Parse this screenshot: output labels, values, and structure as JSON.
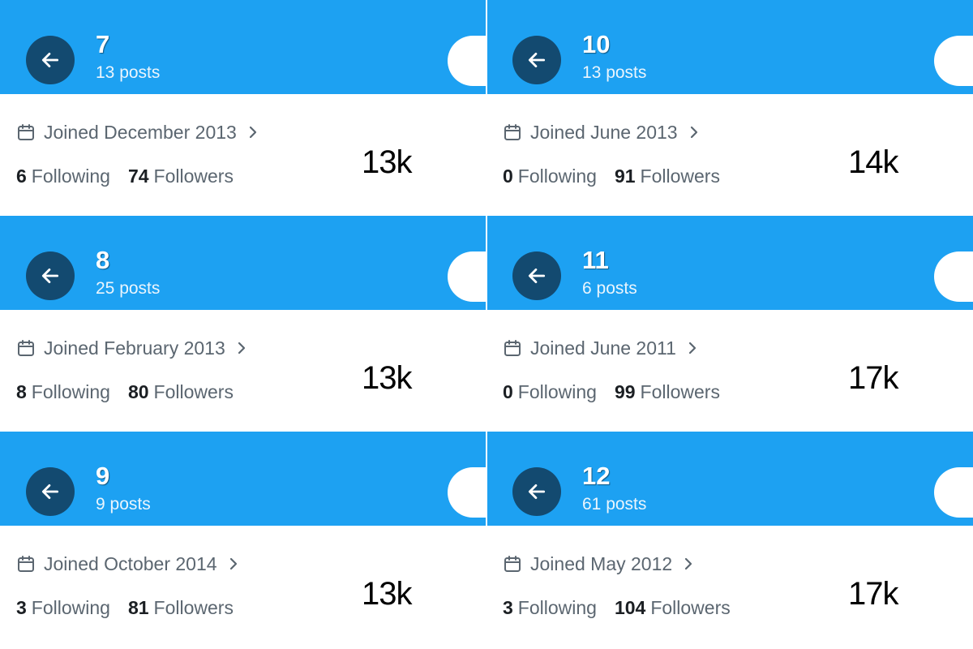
{
  "panels": [
    {
      "name": "7",
      "posts": "13 posts",
      "joined": "Joined December 2013",
      "following_count": "6",
      "following_label": "Following",
      "followers_count": "74",
      "followers_label": "Followers",
      "overlay": "13k"
    },
    {
      "name": "10",
      "posts": "13 posts",
      "joined": "Joined June 2013",
      "following_count": "0",
      "following_label": "Following",
      "followers_count": "91",
      "followers_label": "Followers",
      "overlay": "14k"
    },
    {
      "name": "8",
      "posts": "25 posts",
      "joined": "Joined February 2013",
      "following_count": "8",
      "following_label": "Following",
      "followers_count": "80",
      "followers_label": "Followers",
      "overlay": "13k"
    },
    {
      "name": "11",
      "posts": "6 posts",
      "joined": "Joined June 2011",
      "following_count": "0",
      "following_label": "Following",
      "followers_count": "99",
      "followers_label": "Followers",
      "overlay": "17k"
    },
    {
      "name": "9",
      "posts": "9 posts",
      "joined": "Joined October 2014",
      "following_count": "3",
      "following_label": "Following",
      "followers_count": "81",
      "followers_label": "Followers",
      "overlay": "13k"
    },
    {
      "name": "12",
      "posts": "61 posts",
      "joined": "Joined May 2012",
      "following_count": "3",
      "following_label": "Following",
      "followers_count": "104",
      "followers_label": "Followers",
      "overlay": "17k"
    }
  ],
  "icons": {
    "back": "arrow-left-icon",
    "calendar": "calendar-icon",
    "chevron": "chevron-right-icon"
  },
  "colors": {
    "header": "#1da1f2",
    "back_button": "#134a70",
    "muted_text": "#5b6670",
    "bold_text": "#1b1f23"
  }
}
